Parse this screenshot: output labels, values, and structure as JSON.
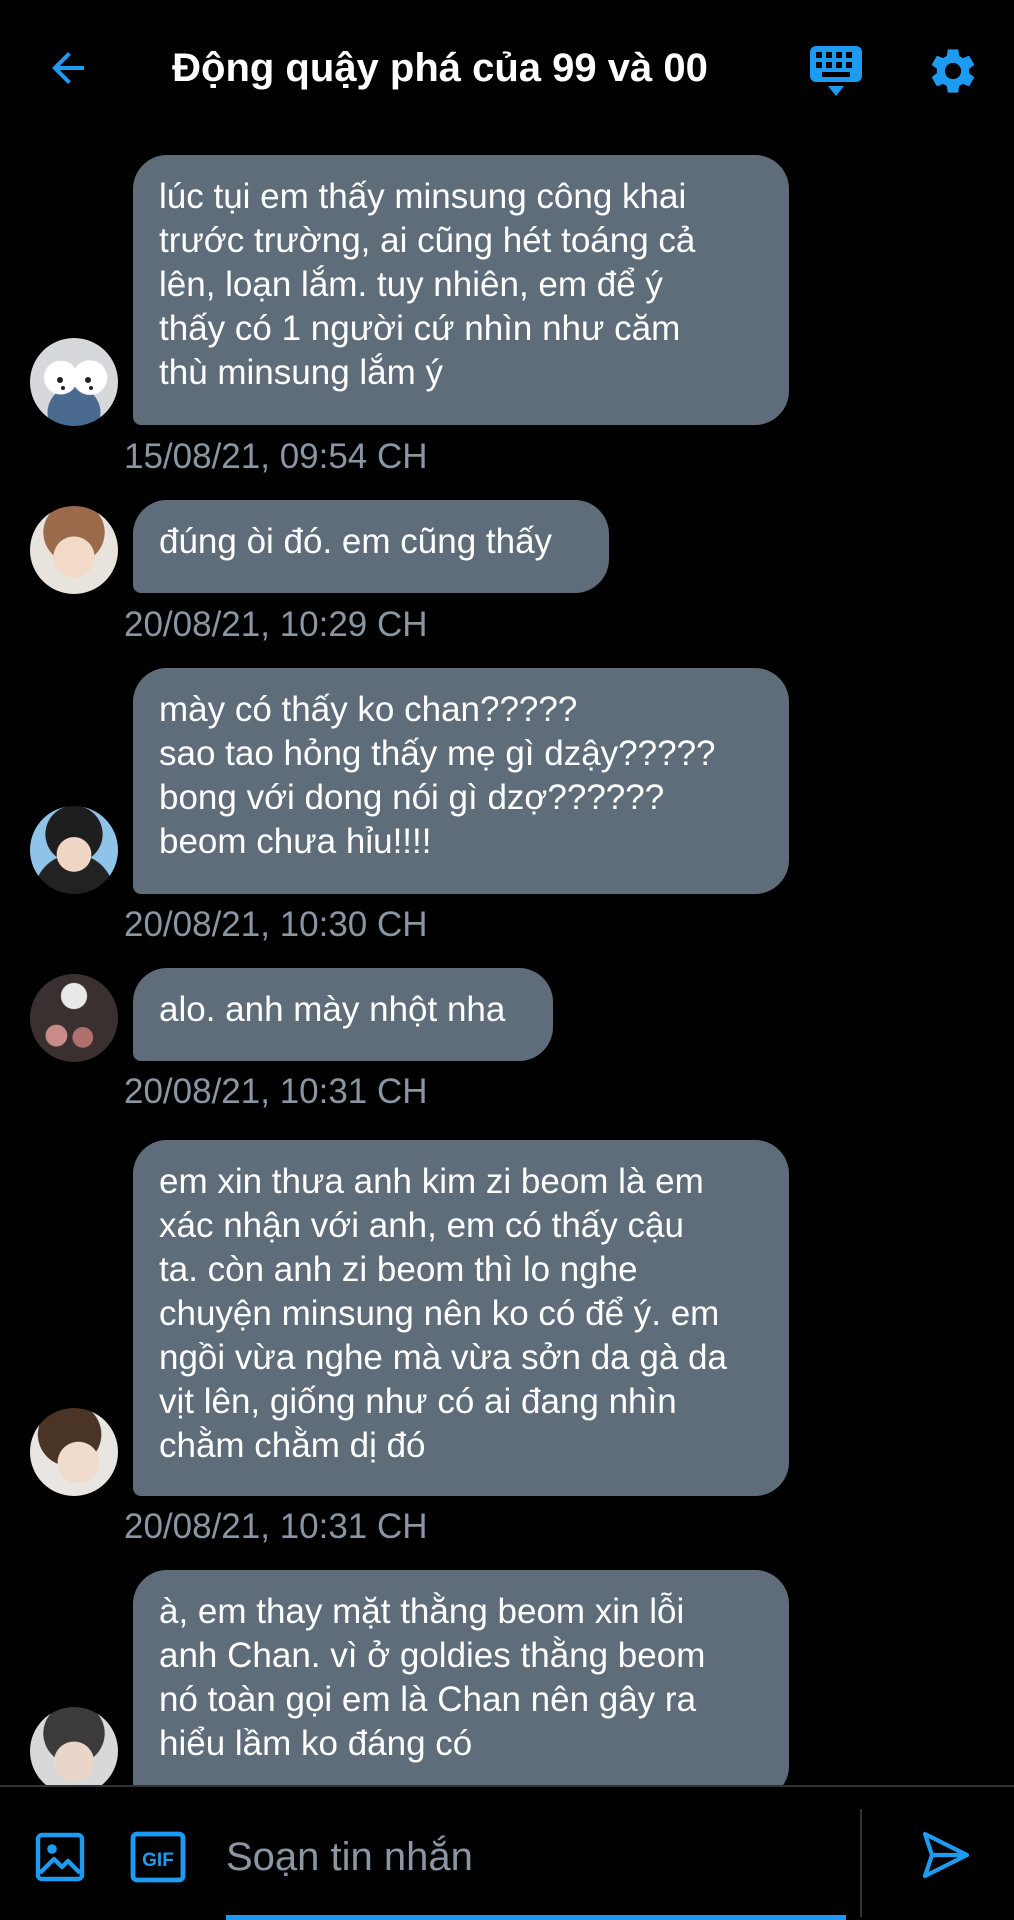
{
  "header": {
    "title": "Động quậy phá của 99 và 00",
    "back_icon": "arrow-left-icon",
    "keyboard_icon": "keyboard-icon",
    "settings_icon": "gear-icon"
  },
  "messages": [
    {
      "text": "lúc tụi em thấy minsung công khai\ntrước trường, ai cũng hét toáng cả\nlên, loạn lắm. tuy nhiên, em để ý\nthấy có 1 người cứ nhìn như căm\nthù minsung lắm ý",
      "time": "15/08/21, 09:54 CH"
    },
    {
      "text": "đúng òi đó. em cũng thấy",
      "time": "20/08/21, 10:29 CH"
    },
    {
      "text": "mày có thấy ko chan?????\nsao tao hỏng thấy mẹ gì dzậy?????\nbong với dong nói gì dzợ??????\nbeom chưa hỉu!!!!",
      "time": "20/08/21, 10:30 CH"
    },
    {
      "text": "alo. anh mày nhột nha",
      "time": "20/08/21, 10:31 CH"
    },
    {
      "text": "em xin thưa anh kim zi beom là em\nxác nhận với anh, em có thấy cậu\nta. còn anh zi beom thì lo nghe\nchuyện minsung nên ko có để ý. em\nngồi vừa nghe mà vừa sởn da gà da\nvịt lên, giống như có ai đang nhìn\nchằm chằm dị đó",
      "time": "20/08/21, 10:31 CH"
    },
    {
      "text": "à, em thay mặt thằng beom xin lỗi\nanh Chan. vì ở goldies thằng beom\nnó toàn gọi em là Chan nên gây ra\nhiểu lầm ko đáng có",
      "time": ""
    }
  ],
  "composer": {
    "placeholder": "Soạn tin nhắn",
    "image_icon": "image-icon",
    "gif_icon": "gif-icon",
    "gif_label": "GIF",
    "send_icon": "send-icon"
  },
  "colors": {
    "accent": "#1d9bf0",
    "bubble": "#5f6d7a",
    "timestamp": "#8a96a3",
    "background": "#000000"
  }
}
